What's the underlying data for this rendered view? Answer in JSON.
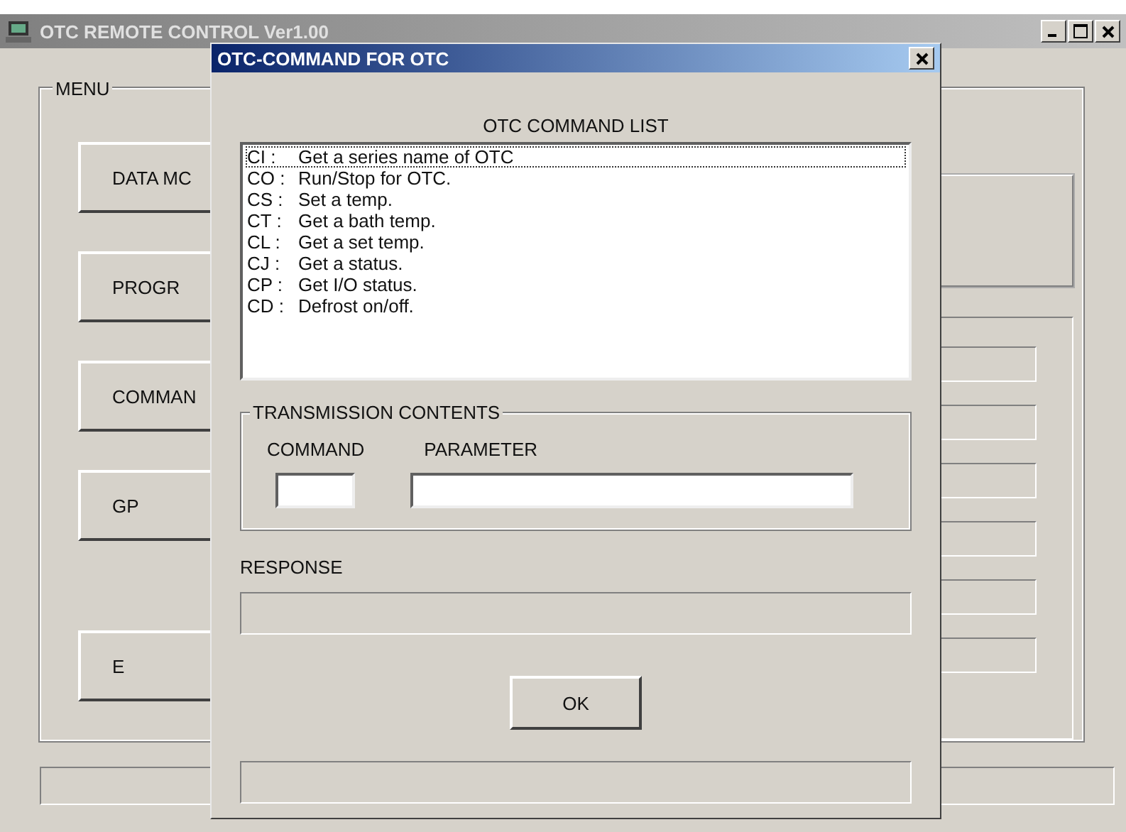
{
  "main_window": {
    "title": "OTC REMOTE CONTROL Ver1.00",
    "menu": {
      "label": "MENU",
      "buttons": [
        "DATA MC",
        "PROGR",
        "COMMAN",
        "GP",
        "E"
      ]
    }
  },
  "dialog": {
    "title": "OTC-COMMAND FOR OTC",
    "list_heading": "OTC COMMAND LIST",
    "commands": [
      {
        "code": "CI :",
        "description": "Get a series name of OTC",
        "selected": true
      },
      {
        "code": "CO :",
        "description": "Run/Stop for OTC.",
        "selected": false
      },
      {
        "code": "CS :",
        "description": "Set a temp.",
        "selected": false
      },
      {
        "code": "CT :",
        "description": "Get a bath temp.",
        "selected": false
      },
      {
        "code": "CL :",
        "description": "Get a set temp.",
        "selected": false
      },
      {
        "code": "CJ :",
        "description": "Get a status.",
        "selected": false
      },
      {
        "code": "CP :",
        "description": "Get I/O status.",
        "selected": false
      },
      {
        "code": "CD :",
        "description": "Defrost on/off.",
        "selected": false
      }
    ],
    "transmission": {
      "label": "TRANSMISSION CONTENTS",
      "command_label": "COMMAND",
      "parameter_label": "PARAMETER"
    },
    "response_label": "RESPONSE",
    "ok": "OK"
  }
}
